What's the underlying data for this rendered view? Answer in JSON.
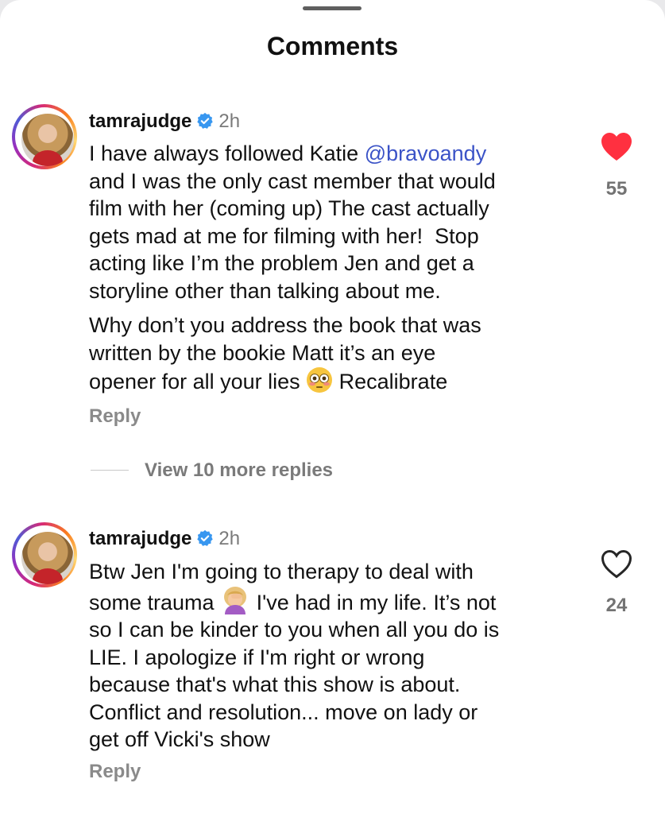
{
  "sheet": {
    "title": "Comments"
  },
  "comments": [
    {
      "username": "tamrajudge",
      "time": "2h",
      "paragraphs": [
        {
          "before": "I have always followed Katie ",
          "mention": "@bravoandy",
          "after": "\nand I was the only cast member that would\nfilm with her (coming up) The cast actually\ngets mad at me for filming with her!  Stop\nacting like I’m the problem Jen and get a\nstoryline other than talking about me."
        },
        {
          "before": "Why don’t you address the book that was\nwritten by the bookie Matt it’s an eye\nopener for all your lies ",
          "emoji": "flushed-face-emoji",
          "after": " Recalibrate"
        }
      ],
      "reply_label": "Reply",
      "likes": "55",
      "liked": true,
      "view_more": "View 10 more replies"
    },
    {
      "username": "tamrajudge",
      "time": "2h",
      "paragraphs": [
        {
          "before": "Btw Jen I'm going to therapy to deal with\nsome trauma ",
          "emoji": "woman-facepalming-emoji",
          "after": " I've had in my life. It’s not\nso I can be kinder to you when all you do is\nLIE. I apologize if I'm right or wrong\nbecause that's what this show is about.\nConflict and resolution... move on lady or\nget off Vicki's show"
        }
      ],
      "reply_label": "Reply",
      "likes": "24",
      "liked": false
    }
  ],
  "colors": {
    "mention": "#3b53c7",
    "like_active": "#ff3040",
    "secondary_text": "#7a7a7a",
    "verified": "#3897f0"
  }
}
